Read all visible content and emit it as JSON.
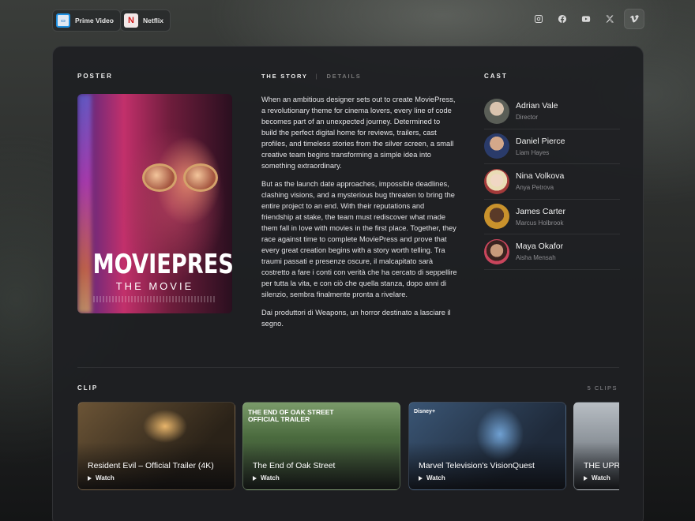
{
  "providers": [
    {
      "label": "Prime Video",
      "icon": "prime-video-icon"
    },
    {
      "label": "Netflix",
      "icon": "netflix-icon",
      "logo_letter": "N"
    }
  ],
  "socials": [
    "instagram-icon",
    "facebook-icon",
    "youtube-icon",
    "x-icon",
    "vimeo-icon"
  ],
  "poster": {
    "heading": "POSTER",
    "title": "MOVIEPRESS",
    "subtitle": "THE MOVIE"
  },
  "story": {
    "tab_active": "THE STORY",
    "tab_separator": "|",
    "tab_inactive": "DETAILS",
    "paragraphs": [
      "When an ambitious designer sets out to create MoviePress, a revolutionary theme for cinema lovers, every line of code becomes part of an unexpected journey. Determined to build the perfect digital home for reviews, trailers, cast profiles, and timeless stories from the silver screen, a small creative team begins transforming a simple idea into something extraordinary.",
      "But as the launch date approaches, impossible deadlines, clashing visions, and a mysterious bug threaten to bring the entire project to an end. With their reputations and friendship at stake, the team must rediscover what made them fall in love with movies in the first place. Together, they race against time to complete MoviePress and prove that every great creation begins with a story worth telling. Tra traumi passati e presenze oscure, il malcapitato sarà costretto a fare i conti con verità che ha cercato di seppellire per tutta la vita, e con ciò che quella stanza, dopo anni di silenzio, sembra finalmente pronta a rivelare.",
      "Dai produttori di Weapons, un horror destinato a lasciare il segno."
    ]
  },
  "cast": {
    "heading": "CAST",
    "members": [
      {
        "name": "Adrian Vale",
        "role": "Director",
        "color": "#5a5e57"
      },
      {
        "name": "Daniel Pierce",
        "role": "Liam Hayes",
        "color": "#2a3b6a"
      },
      {
        "name": "Nina Volkova",
        "role": "Anya Petrova",
        "color": "#c9b9a8"
      },
      {
        "name": "James Carter",
        "role": "Marcus Holbrook",
        "color": "#b8862a"
      },
      {
        "name": "Maya Okafor",
        "role": "Aisha Mensah",
        "color": "#c9455c"
      }
    ]
  },
  "clips": {
    "heading": "CLIP",
    "count_label": "5 CLIPS",
    "watch_label": "Watch",
    "items": [
      {
        "title": "Resident Evil – Official Trailer (4K)",
        "bg": "#5b4a33"
      },
      {
        "title": "The End of Oak Street",
        "bg": "#4f6a46",
        "tag": "THE END OF OAK STREET OFFICIAL TRAILER"
      },
      {
        "title": "Marvel Television's VisionQuest",
        "bg": "#2e4a6b",
        "tag": "Disney+"
      },
      {
        "title": "THE UPRISING",
        "bg": "#8a8f94"
      }
    ]
  }
}
